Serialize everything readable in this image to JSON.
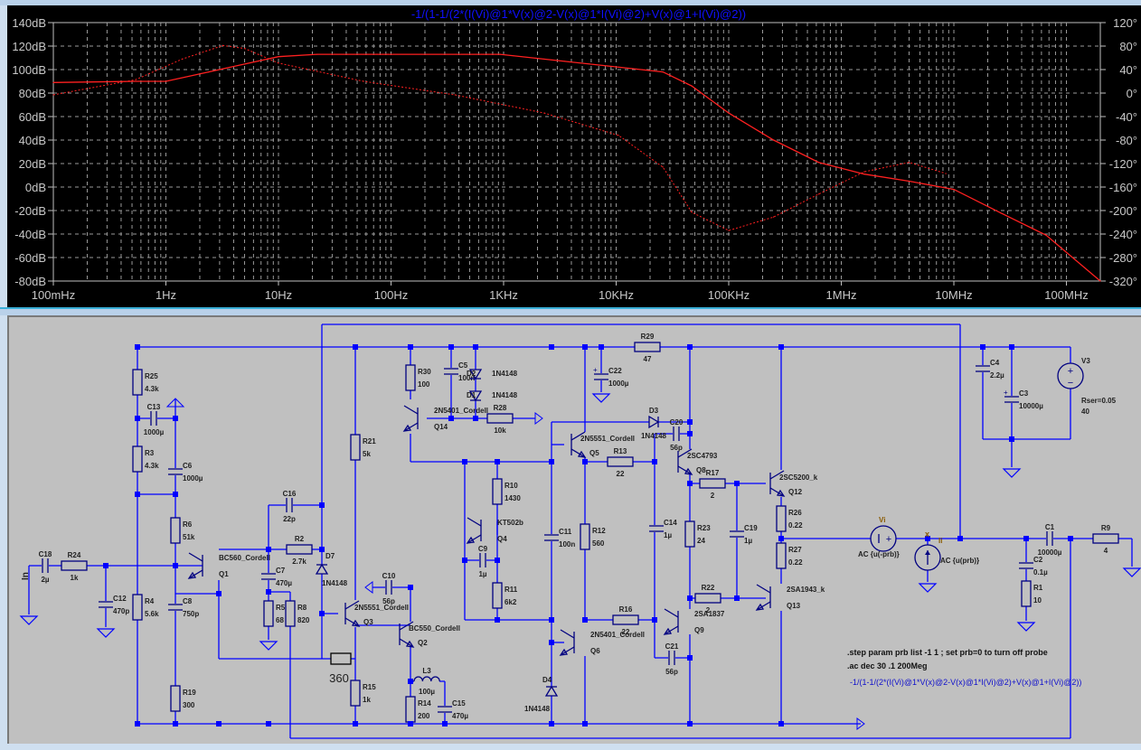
{
  "plot": {
    "expression": "-1/(1-1/(2*(I(Vi)@1*V(x)@2-V(x)@1*I(Vi)@2)+V(x)@1+I(Vi)@2))",
    "trace_color": "#ff2020",
    "expression_color": "#1010ff"
  },
  "chart_data": {
    "type": "line",
    "title": "-1/(1-1/(2*(I(Vi)@1*V(x)@2-V(x)@1*I(Vi)@2)+V(x)@1+I(Vi)@2))",
    "xscale": "log",
    "xlim": [
      0.1,
      200000000
    ],
    "x_tick_labels": [
      "100mHz",
      "1Hz",
      "10Hz",
      "100Hz",
      "1KHz",
      "10KHz",
      "100KHz",
      "1MHz",
      "10MHz",
      "100MHz"
    ],
    "x_tick_values": [
      0.1,
      1,
      10,
      100,
      1000,
      10000,
      100000,
      1000000,
      10000000,
      100000000
    ],
    "ylim_left": [
      -80,
      140
    ],
    "y_left_tick_labels": [
      "140dB",
      "120dB",
      "100dB",
      "80dB",
      "60dB",
      "40dB",
      "20dB",
      "0dB",
      "-20dB",
      "-40dB",
      "-60dB",
      "-80dB"
    ],
    "y_left_tick_values": [
      140,
      120,
      100,
      80,
      60,
      40,
      20,
      0,
      -20,
      -40,
      -60,
      -80
    ],
    "ylim_right": [
      -320,
      120
    ],
    "y_right_tick_labels": [
      "120°",
      "80°",
      "40°",
      "0°",
      "-40°",
      "-80°",
      "-120°",
      "-160°",
      "-200°",
      "-240°",
      "-280°",
      "-320°"
    ],
    "y_right_tick_values": [
      120,
      80,
      40,
      0,
      -40,
      -80,
      -120,
      -160,
      -200,
      -240,
      -280,
      -320
    ],
    "grid": true,
    "series": [
      {
        "name": "magnitude (dB)",
        "style": "solid",
        "x": [
          0.1,
          0.54,
          1,
          2.4,
          10,
          22,
          930,
          3500,
          26000,
          47000,
          100000,
          250000,
          630000,
          1600000,
          4000000,
          10000000,
          26000000,
          66000000,
          200000000
        ],
        "y": [
          89,
          90,
          90,
          98,
          111,
          113,
          113,
          107,
          98,
          86,
          63,
          40,
          21,
          11,
          5,
          -2,
          -22,
          -41,
          -80
        ]
      },
      {
        "name": "phase (deg)",
        "style": "dotted",
        "x": [
          0.1,
          0.54,
          1.4,
          3.2,
          5,
          10,
          57,
          370,
          2300,
          10500,
          26000,
          47000,
          100000,
          250000,
          630000,
          1600000,
          4000000,
          8500000
        ],
        "y": [
          -3,
          23,
          58,
          81,
          76,
          51,
          20,
          -3,
          -34,
          -72,
          -126,
          -203,
          -234,
          -211,
          -172,
          -134,
          -118,
          -137
        ]
      }
    ]
  },
  "schematic": {
    "components": [
      {
        "ref": "R25",
        "value": "4.3k"
      },
      {
        "ref": "R3",
        "value": "4.3k"
      },
      {
        "ref": "R6",
        "value": "51k"
      },
      {
        "ref": "R4",
        "value": "5.6k"
      },
      {
        "ref": "R19",
        "value": "300"
      },
      {
        "ref": "R24",
        "value": "1k"
      },
      {
        "ref": "R2",
        "value": "2.7k"
      },
      {
        "ref": "R5",
        "value": "68"
      },
      {
        "ref": "R8",
        "value": "820"
      },
      {
        "ref": "",
        "value": "360"
      },
      {
        "ref": "R21",
        "value": "5k"
      },
      {
        "ref": "R15",
        "value": "1k"
      },
      {
        "ref": "R14",
        "value": "200"
      },
      {
        "ref": "R30",
        "value": "100"
      },
      {
        "ref": "R28",
        "value": "10k"
      },
      {
        "ref": "R10",
        "value": "1430"
      },
      {
        "ref": "R11",
        "value": "6k2"
      },
      {
        "ref": "R12",
        "value": "560"
      },
      {
        "ref": "R13",
        "value": "22"
      },
      {
        "ref": "R16",
        "value": "22"
      },
      {
        "ref": "R29",
        "value": "47"
      },
      {
        "ref": "R17",
        "value": "2"
      },
      {
        "ref": "R23",
        "value": "24"
      },
      {
        "ref": "R22",
        "value": "2"
      },
      {
        "ref": "R26",
        "value": "0.22"
      },
      {
        "ref": "R27",
        "value": "0.22"
      },
      {
        "ref": "R1",
        "value": "10"
      },
      {
        "ref": "R9",
        "value": "4"
      },
      {
        "ref": "C13",
        "value": "1000µ"
      },
      {
        "ref": "C6",
        "value": "1000µ"
      },
      {
        "ref": "C18",
        "value": "2µ"
      },
      {
        "ref": "C12",
        "value": "470p"
      },
      {
        "ref": "C8",
        "value": "750p"
      },
      {
        "ref": "C16",
        "value": "22p"
      },
      {
        "ref": "C7",
        "value": "470µ"
      },
      {
        "ref": "C10",
        "value": "56p"
      },
      {
        "ref": "C15",
        "value": "470µ"
      },
      {
        "ref": "C5",
        "value": "100n"
      },
      {
        "ref": "C22",
        "value": "1000µ"
      },
      {
        "ref": "C9",
        "value": "1µ"
      },
      {
        "ref": "C11",
        "value": "100n"
      },
      {
        "ref": "C14",
        "value": "1µ"
      },
      {
        "ref": "C20",
        "value": "56p"
      },
      {
        "ref": "C21",
        "value": "56p"
      },
      {
        "ref": "C19",
        "value": "1µ"
      },
      {
        "ref": "C4",
        "value": "2.2µ"
      },
      {
        "ref": "C3",
        "value": "10000µ"
      },
      {
        "ref": "C2",
        "value": "0.1µ"
      },
      {
        "ref": "C1",
        "value": "10000µ"
      },
      {
        "ref": "D2",
        "value": "1N4148"
      },
      {
        "ref": "D1",
        "value": "1N4148"
      },
      {
        "ref": "D7",
        "value": "1N4148"
      },
      {
        "ref": "D3",
        "value": "1N4148"
      },
      {
        "ref": "D4",
        "value": "1N4148"
      },
      {
        "ref": "L3",
        "value": "100µ"
      },
      {
        "ref": "Q1",
        "value": "BC560_Cordell"
      },
      {
        "ref": "Q3",
        "value": "2N5551_Cordell"
      },
      {
        "ref": "Q2",
        "value": "BC550_Cordell"
      },
      {
        "ref": "Q14",
        "value": "2N5401_Cordell"
      },
      {
        "ref": "Q4",
        "value": "KT502b"
      },
      {
        "ref": "Q5",
        "value": "2N5551_Cordell"
      },
      {
        "ref": "Q6",
        "value": "2N5401_Cordell"
      },
      {
        "ref": "Q8",
        "value": "2SC4793"
      },
      {
        "ref": "Q9",
        "value": "2SA1837"
      },
      {
        "ref": "Q12",
        "value": "2SC5200_k"
      },
      {
        "ref": "Q13",
        "value": "2SA1943_k"
      },
      {
        "ref": "V3",
        "value": "Rser=0.05",
        "value2": "40"
      },
      {
        "ref": "Vi",
        "value": "AC {u(-prb)}"
      },
      {
        "ref": "Ii",
        "value": "AC {u(prb)}"
      }
    ],
    "input_label": "In",
    "net_label_x": "x",
    "directives": [
      ".step param prb list -1 1 ; set prb=0 to turn off probe",
      ".ac dec 30 .1 200Meg"
    ],
    "plot_expression_comment": "-1/(1-1/(2*(I(Vi)@1*V(x)@2-V(x)@1*I(Vi)@2)+V(x)@1+I(Vi)@2))",
    "wire_color": "#0000ff",
    "component_color": "#000080"
  }
}
